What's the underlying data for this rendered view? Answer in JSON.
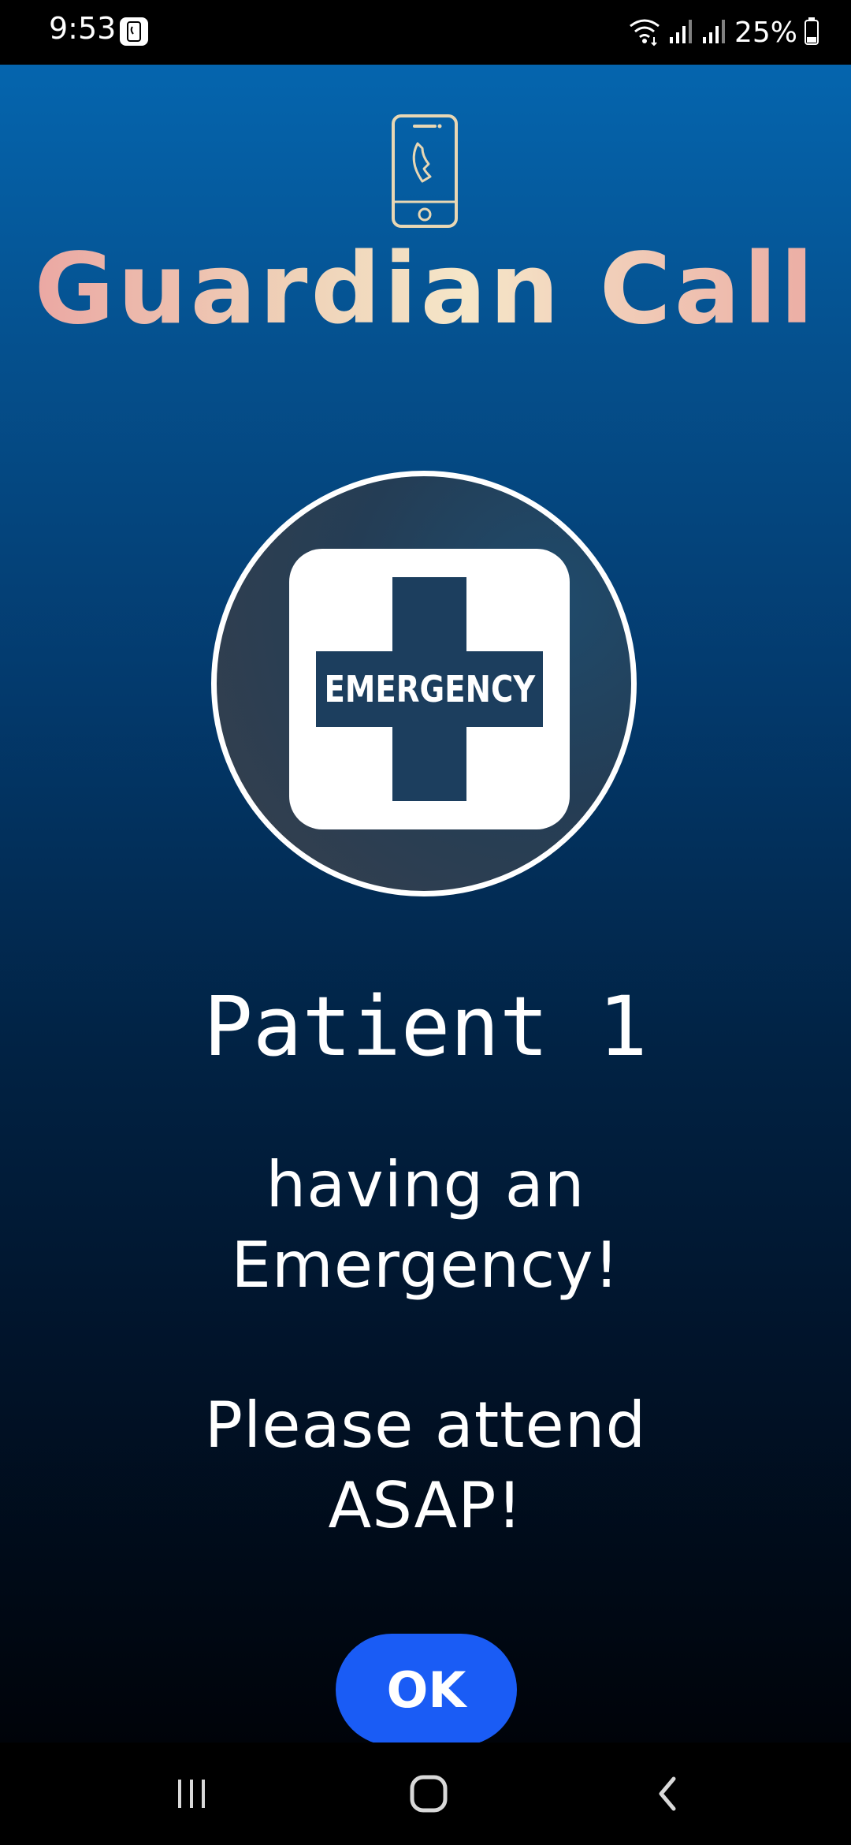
{
  "status_bar": {
    "time": "9:53",
    "battery": "25%"
  },
  "app": {
    "title": "Guardian Call",
    "logo_icon": "phone-call-icon",
    "title_gradient": [
      "#eaa2a0",
      "#f5e6c8"
    ]
  },
  "alert": {
    "badge_label": "EMERGENCY",
    "patient": "Patient 1",
    "message_line1": "having an",
    "message_line2": "Emergency!",
    "instruction_line1": "Please attend",
    "instruction_line2": "ASAP!"
  },
  "actions": {
    "ok_label": "OK"
  },
  "nav": {
    "icons": [
      "recents-icon",
      "home-icon",
      "back-icon"
    ]
  },
  "colors": {
    "accent": "#1a5cf5",
    "background_top": "#0565ae",
    "background_bottom": "#000309",
    "cross": "#1c3e5e"
  }
}
